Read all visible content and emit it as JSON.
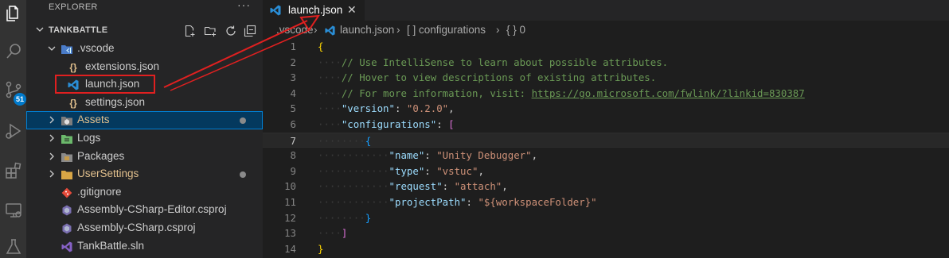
{
  "activity": {
    "items": [
      "explorer-icon",
      "search-icon",
      "source-control-icon",
      "run-debug-icon",
      "extensions-icon",
      "remote-explorer-icon",
      "testing-icon"
    ],
    "scm_badge": "51"
  },
  "sidebar": {
    "title": "EXPLORER",
    "more": "···",
    "section": "TANKBATTLE",
    "items": [
      {
        "label": ".vscode",
        "icon": "vscode-folder-icon",
        "kind": "folder-open",
        "depth": 1
      },
      {
        "label": "extensions.json",
        "icon": "json-icon",
        "kind": "file",
        "depth": 2
      },
      {
        "label": "launch.json",
        "icon": "vscode-json-icon",
        "kind": "file",
        "depth": 2
      },
      {
        "label": "settings.json",
        "icon": "json-icon",
        "kind": "file",
        "depth": 2
      },
      {
        "label": "Assets",
        "icon": "unity-folder-icon",
        "kind": "folder",
        "depth": 0,
        "modified": true
      },
      {
        "label": "Logs",
        "icon": "logs-folder-icon",
        "kind": "folder",
        "depth": 0
      },
      {
        "label": "Packages",
        "icon": "packages-folder-icon",
        "kind": "folder",
        "depth": 0
      },
      {
        "label": "UserSettings",
        "icon": "folder-icon",
        "kind": "folder",
        "depth": 0,
        "modified": true
      },
      {
        "label": ".gitignore",
        "icon": "git-icon",
        "kind": "file",
        "depth": 0
      },
      {
        "label": "Assembly-CSharp-Editor.csproj",
        "icon": "csproj-icon",
        "kind": "file",
        "depth": 0
      },
      {
        "label": "Assembly-CSharp.csproj",
        "icon": "csproj-icon",
        "kind": "file",
        "depth": 0
      },
      {
        "label": "TankBattle.sln",
        "icon": "visual-studio-icon",
        "kind": "file",
        "depth": 0
      }
    ]
  },
  "editor": {
    "tab": {
      "label": "launch.json",
      "close": "✕"
    },
    "breadcrumb": {
      "folder": ".vscode",
      "file": "launch.json",
      "node1": "[ ] configurations",
      "node2": "{ } 0"
    },
    "lines": [
      "{",
      "// Use IntelliSense to learn about possible attributes.",
      "// Hover to view descriptions of existing attributes.",
      "// For more information, visit: https://go.microsoft.com/fwlink/?linkid=830387",
      "\"version\": \"0.2.0\",",
      "\"configurations\": [",
      "{",
      "\"name\": \"Unity Debugger\",",
      "\"type\": \"vstuc\",",
      "\"request\": \"attach\",",
      "\"projectPath\": \"${workspaceFolder}\"",
      "}",
      "]",
      "}"
    ],
    "comment_prefix": "// For more information, visit: ",
    "link": "https://go.microsoft.com/fwlink/?linkid=830387",
    "comment1": "// Use IntelliSense to learn about possible attributes.",
    "comment2": "// Hover to view descriptions of existing attributes.",
    "version_key": "\"version\"",
    "version_val": "\"0.2.0\"",
    "configs_key": "\"configurations\"",
    "name_key": "\"name\"",
    "name_val": "\"Unity Debugger\"",
    "type_key": "\"type\"",
    "type_val": "\"vstuc\"",
    "request_key": "\"request\"",
    "request_val": "\"attach\"",
    "path_key": "\"projectPath\"",
    "path_val": "\"${workspaceFolder}\"",
    "current_line": 7
  },
  "colors": {
    "accent": "#007acc",
    "highlight_box": "#e02020",
    "selection": "#04395e"
  }
}
